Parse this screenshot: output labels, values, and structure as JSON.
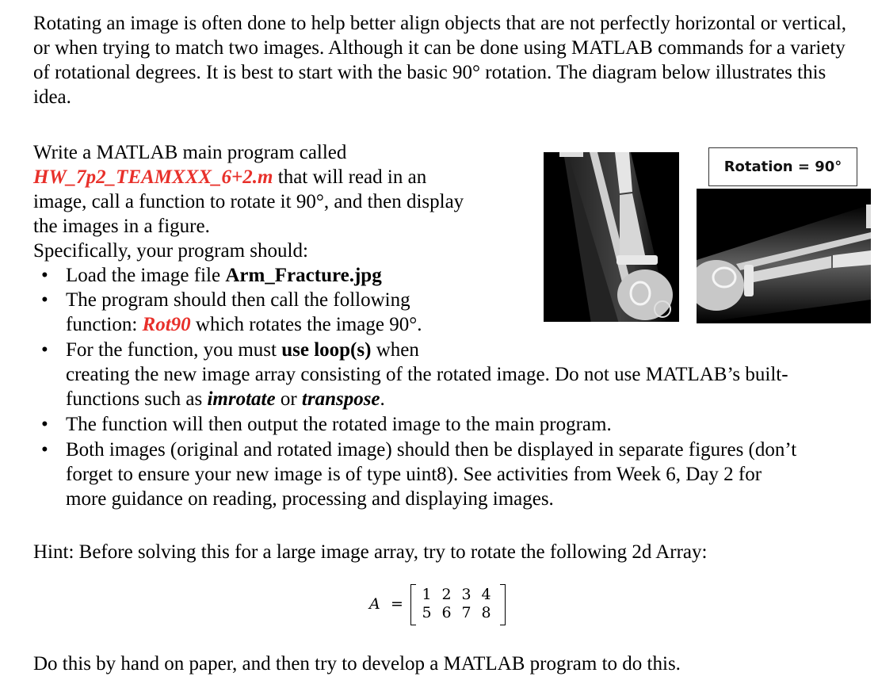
{
  "intro": "Rotating an image is often done to help better align objects that are not perfectly horizontal or vertical, or when trying to match two images.  Although it can be done using MATLAB commands for a variety of rotational degrees.  It is best to start with the basic 90° rotation.  The diagram below illustrates this idea.",
  "task": {
    "line1": "Write a MATLAB main program called",
    "filename": "HW_7p2_TEAMXXX_6+2.m",
    "line2_rest": " that will read in an",
    "line3": "image, call a function to rotate it 90°, and then display",
    "line4": "the images in a figure.",
    "line5": "Specifically, your program should:"
  },
  "bullets": [
    {
      "pre": "Load the image file ",
      "bold": "Arm_Fracture.jpg"
    },
    {
      "line1": "The program should then call the following",
      "pre": "function: ",
      "func": "Rot90",
      "post": " which rotates the image 90°."
    },
    {
      "pre": "For the function, you must ",
      "bold": "use loop(s)",
      "post": " when",
      "line2": "creating the new image array consisting of the rotated image.  Do not use MATLAB’s built-",
      "line3_pre": "functions such as ",
      "bi1": "imrotate",
      "mid": " or ",
      "bi2": "transpose",
      "end": "."
    },
    {
      "text": "The function will then output the rotated image to the main program."
    },
    {
      "line1": "Both images (original and rotated image) should then be displayed in separate figures (don’t",
      "line2": "forget to ensure your new image is of type uint8).  See activities from Week 6, Day 2 for",
      "line3": "more guidance on reading, processing and displaying images."
    }
  ],
  "bullet_glyph": "•",
  "figure": {
    "original_alt": "X-ray of fractured forearm (original orientation)",
    "rotated_alt": "X-ray of fractured forearm rotated 90°",
    "label": "Rotation = 90°"
  },
  "hint": "Hint: Before solving this for a large image array, try to rotate the following 2d Array:",
  "matrix": {
    "name": "A",
    "eq": "=",
    "rows": [
      [
        "1",
        "2",
        "3",
        "4"
      ],
      [
        "5",
        "6",
        "7",
        "8"
      ]
    ]
  },
  "closing": "Do this by hand on paper, and then try to develop a MATLAB program to do this.",
  "colors": {
    "highlight_red": "#e8302a"
  }
}
